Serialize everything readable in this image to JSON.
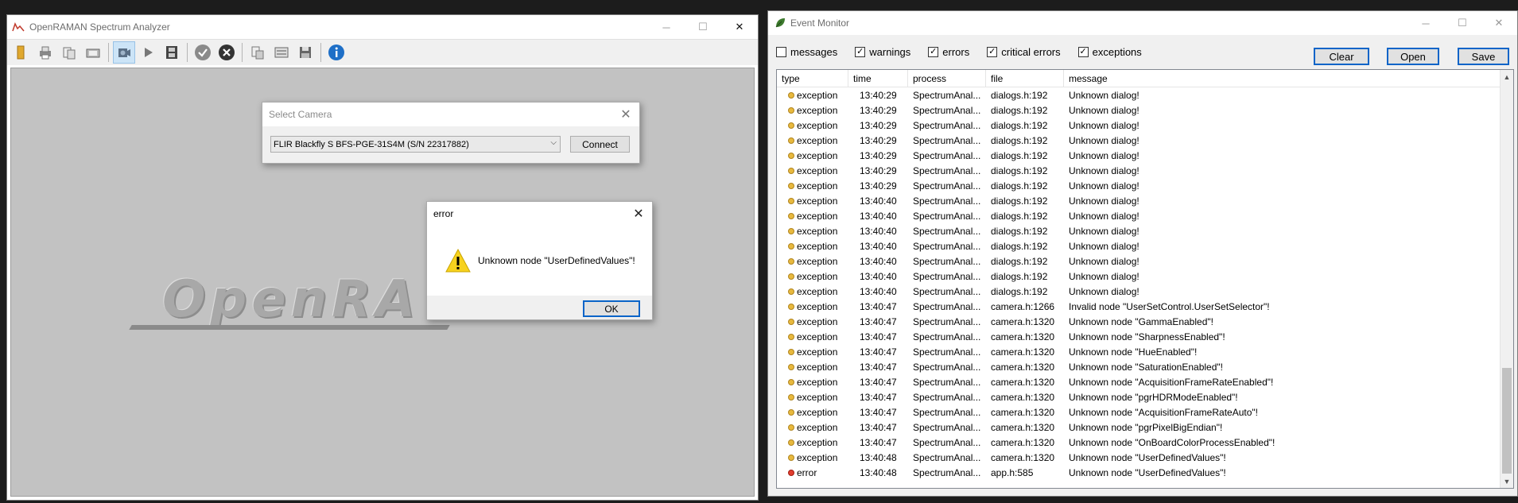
{
  "spectrum_window": {
    "title": "OpenRAMAN Spectrum Analyzer",
    "logo_text": "OpenRA",
    "toolbar_icons": [
      "folder-icon",
      "printer-icon",
      "export-icon",
      "snapshot-icon",
      "camera-icon",
      "play-icon",
      "film-icon",
      "check-icon",
      "cancel-icon",
      "clipboard-icon",
      "list-icon",
      "save-icon",
      "info-icon"
    ]
  },
  "select_camera": {
    "title": "Select Camera",
    "selected_camera": "FLIR Blackfly S BFS-PGE-31S4M (S/N 22317882)",
    "connect_label": "Connect"
  },
  "error_dialog": {
    "title": "error",
    "message": "Unknown node \"UserDefinedValues\"!",
    "ok_label": "OK"
  },
  "event_monitor": {
    "title": "Event Monitor",
    "filters": [
      {
        "label": "messages",
        "checked": false
      },
      {
        "label": "warnings",
        "checked": true
      },
      {
        "label": "errors",
        "checked": true
      },
      {
        "label": "critical errors",
        "checked": true
      },
      {
        "label": "exceptions",
        "checked": true
      }
    ],
    "buttons": {
      "clear": "Clear",
      "open": "Open",
      "save": "Save"
    },
    "columns": {
      "type": "type",
      "time": "time",
      "process": "process",
      "file": "file",
      "message": "message"
    },
    "rows": [
      {
        "type": "exception",
        "time": "13:40:29",
        "process": "SpectrumAnal...",
        "file": "dialogs.h:192",
        "message": "Unknown dialog!"
      },
      {
        "type": "exception",
        "time": "13:40:29",
        "process": "SpectrumAnal...",
        "file": "dialogs.h:192",
        "message": "Unknown dialog!"
      },
      {
        "type": "exception",
        "time": "13:40:29",
        "process": "SpectrumAnal...",
        "file": "dialogs.h:192",
        "message": "Unknown dialog!"
      },
      {
        "type": "exception",
        "time": "13:40:29",
        "process": "SpectrumAnal...",
        "file": "dialogs.h:192",
        "message": "Unknown dialog!"
      },
      {
        "type": "exception",
        "time": "13:40:29",
        "process": "SpectrumAnal...",
        "file": "dialogs.h:192",
        "message": "Unknown dialog!"
      },
      {
        "type": "exception",
        "time": "13:40:29",
        "process": "SpectrumAnal...",
        "file": "dialogs.h:192",
        "message": "Unknown dialog!"
      },
      {
        "type": "exception",
        "time": "13:40:29",
        "process": "SpectrumAnal...",
        "file": "dialogs.h:192",
        "message": "Unknown dialog!"
      },
      {
        "type": "exception",
        "time": "13:40:40",
        "process": "SpectrumAnal...",
        "file": "dialogs.h:192",
        "message": "Unknown dialog!"
      },
      {
        "type": "exception",
        "time": "13:40:40",
        "process": "SpectrumAnal...",
        "file": "dialogs.h:192",
        "message": "Unknown dialog!"
      },
      {
        "type": "exception",
        "time": "13:40:40",
        "process": "SpectrumAnal...",
        "file": "dialogs.h:192",
        "message": "Unknown dialog!"
      },
      {
        "type": "exception",
        "time": "13:40:40",
        "process": "SpectrumAnal...",
        "file": "dialogs.h:192",
        "message": "Unknown dialog!"
      },
      {
        "type": "exception",
        "time": "13:40:40",
        "process": "SpectrumAnal...",
        "file": "dialogs.h:192",
        "message": "Unknown dialog!"
      },
      {
        "type": "exception",
        "time": "13:40:40",
        "process": "SpectrumAnal...",
        "file": "dialogs.h:192",
        "message": "Unknown dialog!"
      },
      {
        "type": "exception",
        "time": "13:40:40",
        "process": "SpectrumAnal...",
        "file": "dialogs.h:192",
        "message": "Unknown dialog!"
      },
      {
        "type": "exception",
        "time": "13:40:47",
        "process": "SpectrumAnal...",
        "file": "camera.h:1266",
        "message": "Invalid node \"UserSetControl.UserSetSelector\"!"
      },
      {
        "type": "exception",
        "time": "13:40:47",
        "process": "SpectrumAnal...",
        "file": "camera.h:1320",
        "message": "Unknown node \"GammaEnabled\"!"
      },
      {
        "type": "exception",
        "time": "13:40:47",
        "process": "SpectrumAnal...",
        "file": "camera.h:1320",
        "message": "Unknown node \"SharpnessEnabled\"!"
      },
      {
        "type": "exception",
        "time": "13:40:47",
        "process": "SpectrumAnal...",
        "file": "camera.h:1320",
        "message": "Unknown node \"HueEnabled\"!"
      },
      {
        "type": "exception",
        "time": "13:40:47",
        "process": "SpectrumAnal...",
        "file": "camera.h:1320",
        "message": "Unknown node \"SaturationEnabled\"!"
      },
      {
        "type": "exception",
        "time": "13:40:47",
        "process": "SpectrumAnal...",
        "file": "camera.h:1320",
        "message": "Unknown node \"AcquisitionFrameRateEnabled\"!"
      },
      {
        "type": "exception",
        "time": "13:40:47",
        "process": "SpectrumAnal...",
        "file": "camera.h:1320",
        "message": "Unknown node \"pgrHDRModeEnabled\"!"
      },
      {
        "type": "exception",
        "time": "13:40:47",
        "process": "SpectrumAnal...",
        "file": "camera.h:1320",
        "message": "Unknown node \"AcquisitionFrameRateAuto\"!"
      },
      {
        "type": "exception",
        "time": "13:40:47",
        "process": "SpectrumAnal...",
        "file": "camera.h:1320",
        "message": "Unknown node \"pgrPixelBigEndian\"!"
      },
      {
        "type": "exception",
        "time": "13:40:47",
        "process": "SpectrumAnal...",
        "file": "camera.h:1320",
        "message": "Unknown node \"OnBoardColorProcessEnabled\"!"
      },
      {
        "type": "exception",
        "time": "13:40:48",
        "process": "SpectrumAnal...",
        "file": "camera.h:1320",
        "message": "Unknown node \"UserDefinedValues\"!"
      },
      {
        "type": "error",
        "time": "13:40:48",
        "process": "SpectrumAnal...",
        "file": "app.h:585",
        "message": "Unknown node \"UserDefinedValues\"!"
      }
    ]
  }
}
